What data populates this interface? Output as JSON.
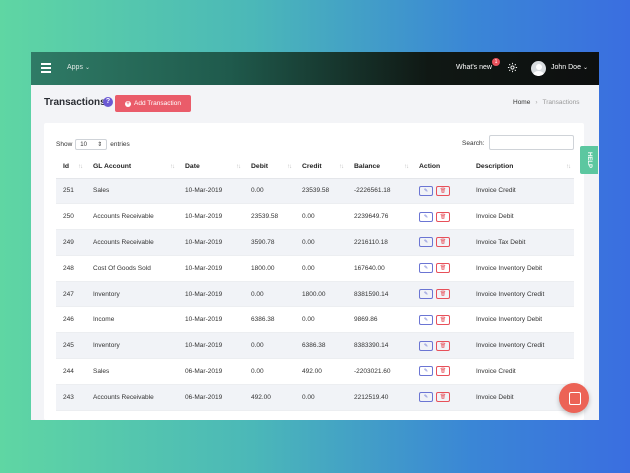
{
  "topbar": {
    "apps_label": "Apps",
    "whats_new_label": "What's new",
    "notification_count": "1",
    "user_name": "John Doe"
  },
  "header": {
    "title": "Transactions",
    "help_glyph": "?",
    "add_button_label": "Add Transaction",
    "breadcrumb_home": "Home",
    "breadcrumb_current": "Transactions"
  },
  "controls": {
    "show_label": "Show",
    "entries_value": "10",
    "entries_label": "entries",
    "search_label": "Search:"
  },
  "table": {
    "columns": [
      "Id",
      "GL Account",
      "Date",
      "Debit",
      "Credit",
      "Balance",
      "Action",
      "Description"
    ],
    "rows": [
      {
        "id": "251",
        "account": "Sales",
        "date": "10-Mar-2019",
        "debit": "0.00",
        "credit": "23539.58",
        "balance": "-2226561.18",
        "description": "Invoice Credit"
      },
      {
        "id": "250",
        "account": "Accounts Receivable",
        "date": "10-Mar-2019",
        "debit": "23539.58",
        "credit": "0.00",
        "balance": "2239649.76",
        "description": "Invoice Debit"
      },
      {
        "id": "249",
        "account": "Accounts Receivable",
        "date": "10-Mar-2019",
        "debit": "3590.78",
        "credit": "0.00",
        "balance": "2216110.18",
        "description": "Invoice Tax Debit"
      },
      {
        "id": "248",
        "account": "Cost Of Goods Sold",
        "date": "10-Mar-2019",
        "debit": "1800.00",
        "credit": "0.00",
        "balance": "167640.00",
        "description": "Invoice Inventory Debit"
      },
      {
        "id": "247",
        "account": "Inventory",
        "date": "10-Mar-2019",
        "debit": "0.00",
        "credit": "1800.00",
        "balance": "8381590.14",
        "description": "Invoice Inventory Credit"
      },
      {
        "id": "246",
        "account": "Income",
        "date": "10-Mar-2019",
        "debit": "6386.38",
        "credit": "0.00",
        "balance": "9869.86",
        "description": "Invoice Inventory Debit"
      },
      {
        "id": "245",
        "account": "Inventory",
        "date": "10-Mar-2019",
        "debit": "0.00",
        "credit": "6386.38",
        "balance": "8383390.14",
        "description": "Invoice Inventory Credit"
      },
      {
        "id": "244",
        "account": "Sales",
        "date": "06-Mar-2019",
        "debit": "0.00",
        "credit": "492.00",
        "balance": "-2203021.60",
        "description": "Invoice Credit"
      },
      {
        "id": "243",
        "account": "Accounts Receivable",
        "date": "06-Mar-2019",
        "debit": "492.00",
        "credit": "0.00",
        "balance": "2212519.40",
        "description": "Invoice Debit"
      }
    ]
  },
  "help_tab_label": "HELP",
  "icons": {
    "menu": "hamburger-icon",
    "settings": "gear-icon",
    "edit": "edit-icon",
    "delete": "trash-icon",
    "chat": "chat-icon"
  },
  "colors": {
    "accent_red": "#ea5c6a",
    "help_purple": "#6b59d3",
    "help_tab_green": "#5cc7a0"
  }
}
